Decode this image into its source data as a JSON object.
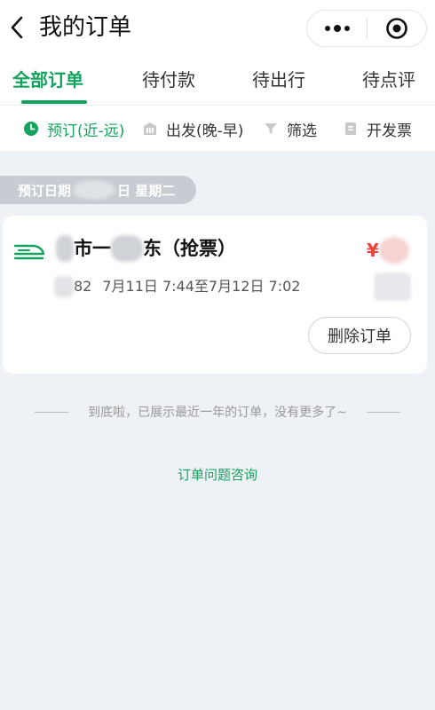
{
  "header": {
    "title": "我的订单",
    "back_icon": "chevron-left-icon",
    "more_icon": "more-dots-icon",
    "target_icon": "target-icon"
  },
  "tabs": [
    {
      "label": "全部订单",
      "active": true
    },
    {
      "label": "待付款",
      "active": false
    },
    {
      "label": "待出行",
      "active": false
    },
    {
      "label": "待点评",
      "active": false
    }
  ],
  "filters": [
    {
      "label": "预订(近-远)",
      "icon": "clock-icon",
      "active": true
    },
    {
      "label": "出发(晚-早)",
      "icon": "building-icon",
      "active": false
    },
    {
      "label": "筛选",
      "icon": "funnel-icon",
      "active": false
    },
    {
      "label": "开发票",
      "icon": "invoice-icon",
      "active": false
    }
  ],
  "date_group": {
    "prefix": "预订日期",
    "suffix": "日 星期二"
  },
  "order": {
    "route_part1": "",
    "route_part2": "市一",
    "route_part3": "东（抢票）",
    "price": "¥",
    "train_suffix": "82",
    "time_range": "7月11日 7:44至7月12日 7:02",
    "delete_label": "删除订单"
  },
  "footer": {
    "end_text": "到底啦，已展示最近一年的订单，没有更多了~",
    "consult_label": "订单问题咨询"
  },
  "colors": {
    "accent": "#14a35e",
    "price": "#f0413b",
    "background": "#eef1f5"
  }
}
